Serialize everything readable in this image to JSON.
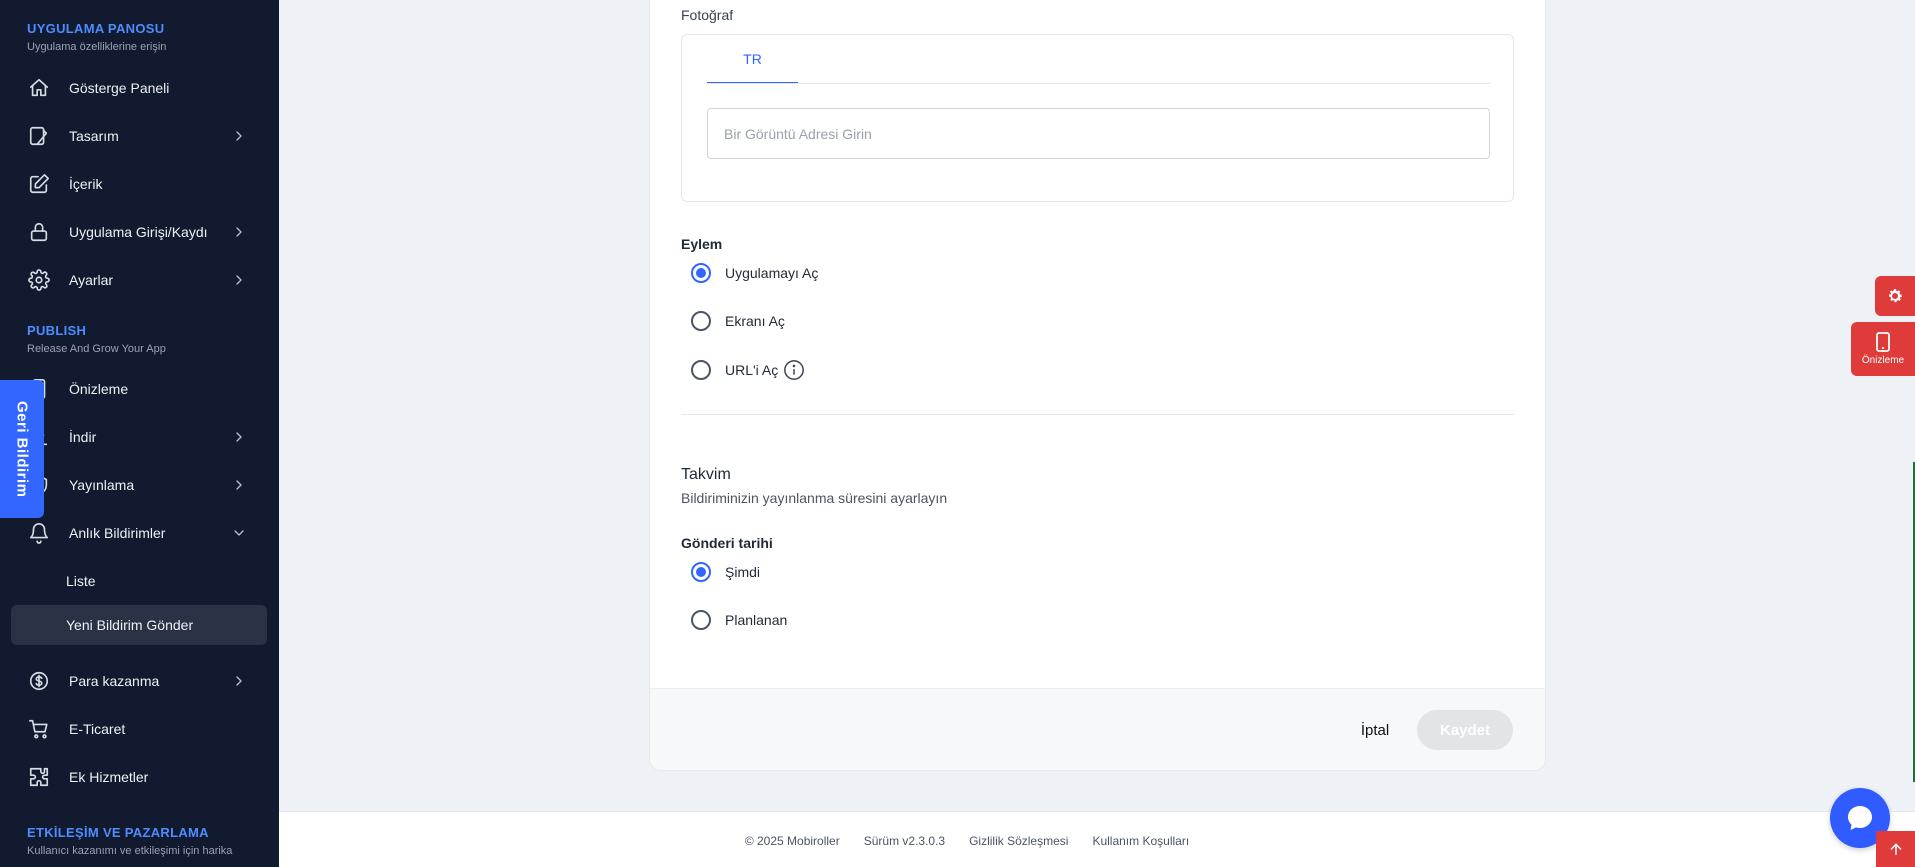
{
  "sidebar": {
    "section1": {
      "title": "UYGULAMA PANOSU",
      "subtitle": "Uygulama özelliklerine erişin"
    },
    "items1": [
      {
        "label": "Gösterge Paneli",
        "icon": "home-icon"
      },
      {
        "label": "Tasarım",
        "icon": "design-icon"
      },
      {
        "label": "İçerik",
        "icon": "edit-icon"
      },
      {
        "label": "Uygulama Girişi/Kaydı",
        "icon": "lock-icon"
      },
      {
        "label": "Ayarlar",
        "icon": "gear-icon"
      }
    ],
    "section2": {
      "title": "PUBLISH",
      "subtitle": "Release And Grow Your App"
    },
    "items2": [
      {
        "label": "Önizleme",
        "icon": "phone-icon"
      },
      {
        "label": "İndir",
        "icon": "download-icon"
      },
      {
        "label": "Yayınlama",
        "icon": "shield-icon"
      },
      {
        "label": "Anlık Bildirimler",
        "icon": "bell-icon"
      }
    ],
    "sub_items": [
      {
        "label": "Liste"
      },
      {
        "label": "Yeni Bildirim Gönder"
      }
    ],
    "items3": [
      {
        "label": "Para kazanma",
        "icon": "dollar-icon"
      },
      {
        "label": "E-Ticaret",
        "icon": "cart-icon"
      },
      {
        "label": "Ek Hizmetler",
        "icon": "puzzle-icon"
      }
    ],
    "section3": {
      "title": "ETKİLEŞİM VE PAZARLAMA",
      "subtitle": "Kullanıcı kazanımı ve etkileşimi için harika"
    }
  },
  "feedback_label": "Geri Bildirim",
  "form": {
    "photo_label": "Fotoğraf",
    "lang_tab": "TR",
    "image_placeholder": "Bir Görüntü Adresi Girin",
    "action_label": "Eylem",
    "actions": [
      {
        "label": "Uygulamayı Aç",
        "selected": true
      },
      {
        "label": "Ekranı Aç",
        "selected": false
      },
      {
        "label": "URL'i Aç",
        "selected": false
      }
    ],
    "schedule_title": "Takvim",
    "schedule_desc": "Bildiriminizin yayınlanma süresini ayarlayın",
    "send_date_label": "Gönderi tarihi",
    "send_options": [
      {
        "label": "Şimdi",
        "selected": true
      },
      {
        "label": "Planlanan",
        "selected": false
      }
    ],
    "cancel_label": "İptal",
    "save_label": "Kaydet"
  },
  "footer": {
    "copyright": "© 2025 Mobiroller",
    "version": "Sürüm v2.3.0.3",
    "privacy": "Gizlilik Sözleşmesi",
    "terms": "Kullanım Koşulları"
  },
  "floating": {
    "preview_label": "Önizleme"
  },
  "colors": {
    "accent": "#3366ff",
    "sidebar_bg": "#111a2e",
    "danger": "#e03b3b"
  }
}
